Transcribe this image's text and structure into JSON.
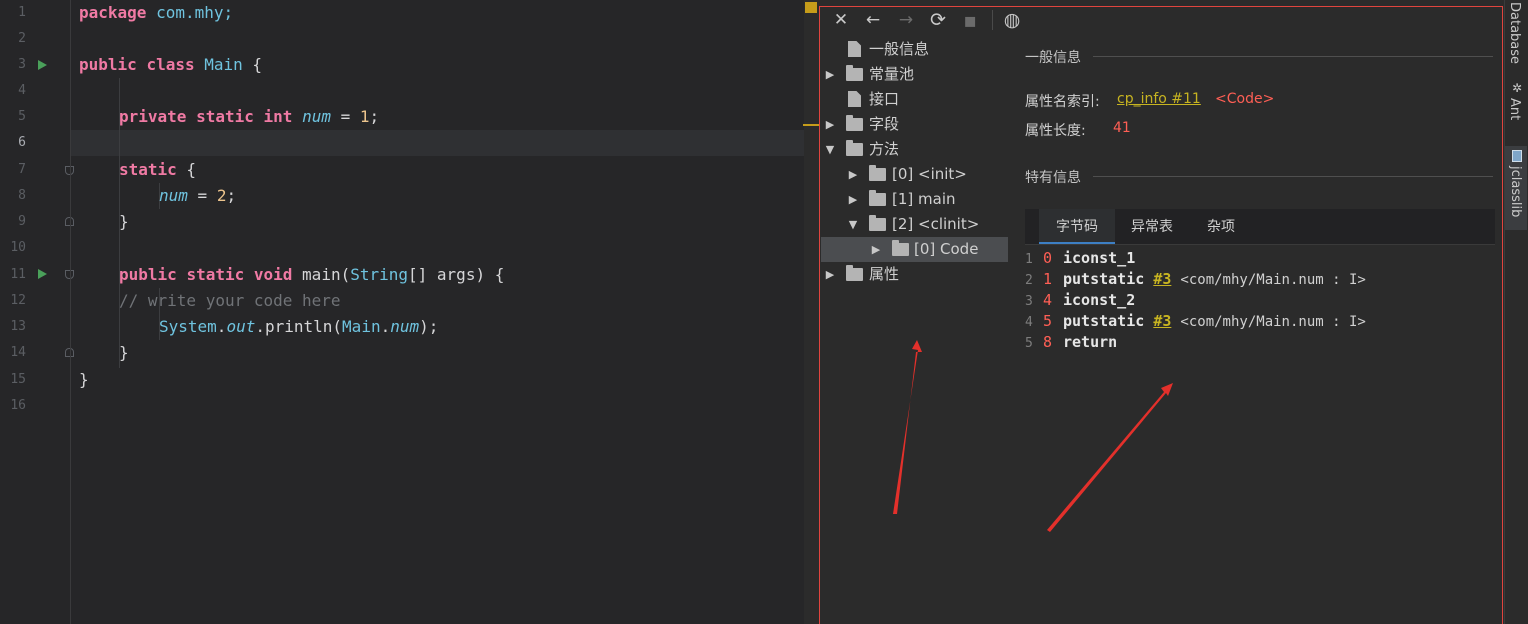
{
  "editor": {
    "line_numbers": [
      "1",
      "2",
      "3",
      "4",
      "5",
      "6",
      "7",
      "8",
      "9",
      "10",
      "11",
      "12",
      "13",
      "14",
      "15",
      "16"
    ],
    "current_line": "6",
    "lines": {
      "l1": {
        "kw": "package",
        "rest": " com.mhy;"
      },
      "l3": {
        "kw1": "public",
        "kw2": "class",
        "name": "Main",
        "rest": " {"
      },
      "l5": {
        "kw1": "private",
        "kw2": "static",
        "kw3": "int",
        "field": "num",
        "eq": " = ",
        "val": "1",
        "end": ";"
      },
      "l7": {
        "kw": "static",
        "rest": " {"
      },
      "l8": {
        "field": "num",
        "eq": " = ",
        "val": "2",
        "end": ";"
      },
      "l9": {
        "text": "}"
      },
      "l11": {
        "kw1": "public",
        "kw2": "static",
        "kw3": "void",
        "name": "main",
        "open": "(",
        "type": "String",
        "rest": "[] args) {"
      },
      "l12": {
        "comment": "// write your code here"
      },
      "l13": {
        "type": "System",
        "dot1": ".",
        "field": "out",
        "call": ".println(",
        "cls": "Main",
        "dot2": ".",
        "field2": "num",
        "end": ");"
      },
      "l14": {
        "text": "}"
      },
      "l15": {
        "text": "}"
      }
    }
  },
  "toolbar": {
    "close_icon": "close-icon",
    "back_icon": "arrow-left-icon",
    "forward_icon": "arrow-right-icon",
    "refresh_icon": "refresh-icon",
    "save_icon": "save-icon",
    "web_icon": "globe-icon",
    "glyphs": {
      "close": "✕",
      "back": "←",
      "forward": "→",
      "refresh": "⟳",
      "save": "▪",
      "web": "◍"
    }
  },
  "tree": {
    "general": "一般信息",
    "constant_pool": "常量池",
    "interfaces": "接口",
    "fields": "字段",
    "methods": "方法",
    "method_init": "[0] <init>",
    "method_main": "[1] main",
    "method_clinit": "[2] <clinit>",
    "code_attr": "[0] Code",
    "attributes": "属性",
    "arrows": {
      "collapsed": "▶",
      "expanded": "▼"
    }
  },
  "detail": {
    "general_title": "一般信息",
    "name_index_label": "属性名索引:",
    "name_index_link": "cp_info #11",
    "name_index_value": "<Code>",
    "length_label": "属性长度:",
    "length_value": "41",
    "specific_title": "特有信息",
    "tabs": [
      "字节码",
      "异常表",
      "杂项"
    ],
    "active_tab": "字节码"
  },
  "bytecode": [
    {
      "line": "1",
      "offset": "0",
      "op": "iconst_1",
      "ref": "",
      "comment": ""
    },
    {
      "line": "2",
      "offset": "1",
      "op": "putstatic",
      "ref": "#3",
      "comment": "<com/mhy/Main.num : I>"
    },
    {
      "line": "3",
      "offset": "4",
      "op": "iconst_2",
      "ref": "",
      "comment": ""
    },
    {
      "line": "4",
      "offset": "5",
      "op": "putstatic",
      "ref": "#3",
      "comment": "<com/mhy/Main.num : I>"
    },
    {
      "line": "5",
      "offset": "8",
      "op": "return",
      "ref": "",
      "comment": ""
    }
  ],
  "sidebar": {
    "database": "Database",
    "ant": "Ant",
    "jclasslib": "jclasslib"
  },
  "colors": {
    "annotation_red": "#e0443e",
    "keyword": "#f07aa4",
    "type": "#6fc3df",
    "number": "#ecc48d"
  }
}
